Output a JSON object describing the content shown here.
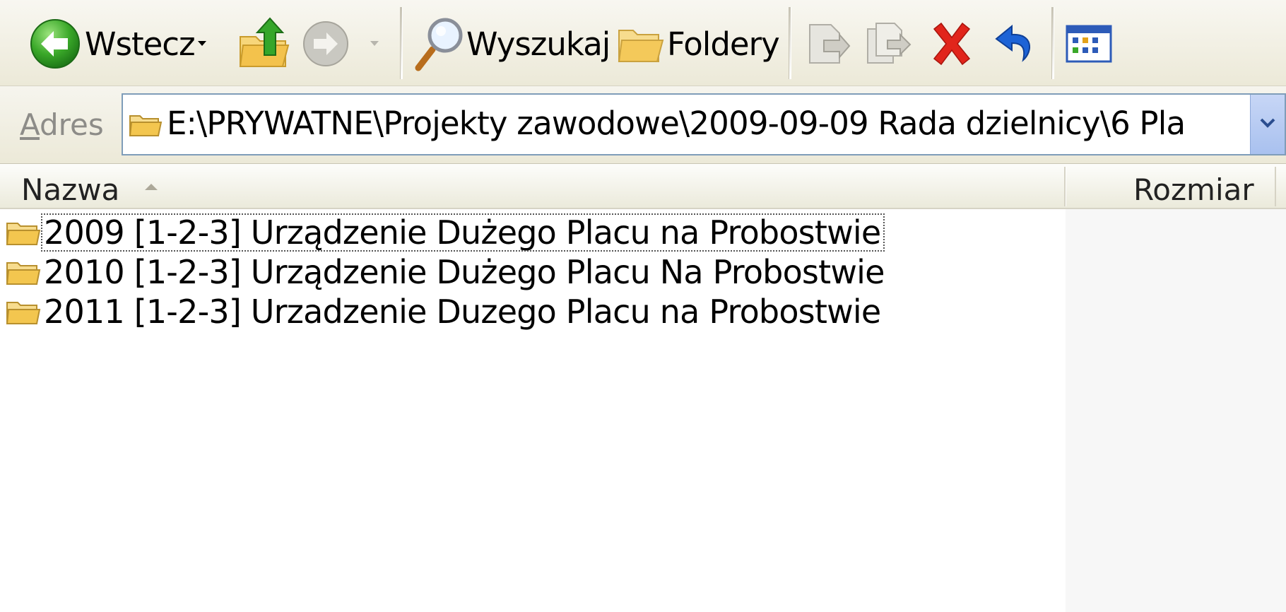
{
  "toolbar": {
    "back_label": "Wstecz",
    "search_label": "Wyszukaj",
    "folders_label": "Foldery"
  },
  "address": {
    "label_accel": "A",
    "label_rest": "dres",
    "path": "E:\\PRYWATNE\\Projekty zawodowe\\2009-09-09 Rada dzielnicy\\6 Pla"
  },
  "columns": {
    "name": "Nazwa",
    "size": "Rozmiar"
  },
  "files": [
    {
      "name": "2009 [1-2-3] Urządzenie Dużego Placu na Probostwie",
      "type": "folder",
      "focused": true
    },
    {
      "name": "2010 [1-2-3] Urządzenie Dużego Placu Na Probostwie",
      "type": "folder",
      "focused": false
    },
    {
      "name": "2011 [1-2-3] Urzadzenie Duzego Placu na Probostwie",
      "type": "folder",
      "focused": false
    }
  ],
  "colors": {
    "toolbar_bg": "#ece9d8",
    "address_border": "#7f9db9",
    "delete_red": "#e1251b",
    "undo_blue": "#1d63d6",
    "back_green": "#3aa829"
  }
}
